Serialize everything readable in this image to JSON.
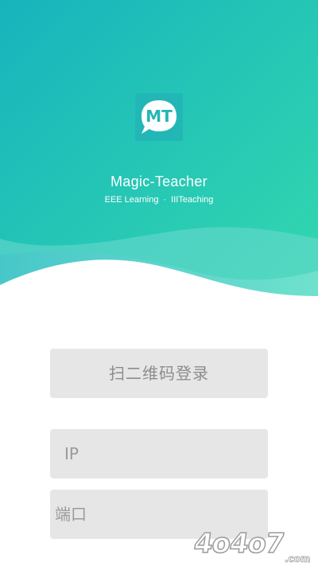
{
  "app": {
    "logo_text": "MT",
    "name": "Magic-Teacher",
    "tagline_left": "EEE Learning",
    "tagline_sep": "·",
    "tagline_right": "IIITeaching"
  },
  "login": {
    "qr_button_label": "扫二维码登录",
    "ip_placeholder": "IP",
    "port_placeholder": "端口"
  },
  "watermark": {
    "text": "4o4o7",
    "suffix": ".com"
  },
  "colors": {
    "gradient_start": "#19b5bb",
    "gradient_end": "#2fd6b0",
    "logo_bg": "#22b7b6",
    "button_bg": "#e6e6e6",
    "placeholder": "#9a9a9a"
  }
}
